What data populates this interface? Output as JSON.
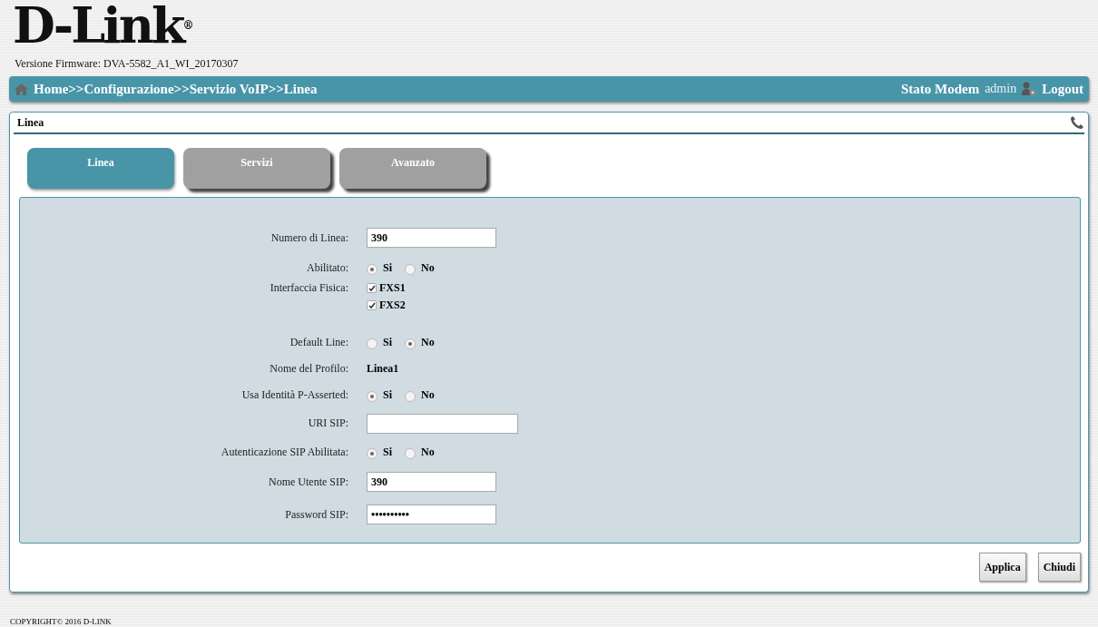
{
  "logo": "D-Link",
  "logo_mark": "®",
  "firmware": "Versione Firmware: DVA-5582_A1_WI_20170307",
  "breadcrumb": "Home>>Configurazione>>Servizio VoIP>>Linea",
  "nav_right": {
    "status_link": "Stato Modem",
    "user": "admin",
    "logout": "Logout"
  },
  "panel": {
    "title": "Linea"
  },
  "tabs": [
    {
      "label": "Linea",
      "selected": true
    },
    {
      "label": "Servizi",
      "selected": false
    },
    {
      "label": "Avanzato",
      "selected": false
    }
  ],
  "fields": [
    {
      "kind": "text",
      "label": "Numero di Linea:",
      "value": "390"
    },
    {
      "kind": "radio",
      "label": "Abilitato:",
      "options": [
        {
          "label": "Si",
          "selected": true
        },
        {
          "label": "No",
          "selected": false
        }
      ]
    },
    {
      "kind": "checkboxes",
      "label": "Interfaccia Fisica:",
      "options": [
        {
          "label": "FXS1",
          "checked": true
        },
        {
          "label": "FXS2",
          "checked": true
        }
      ]
    },
    {
      "kind": "radio",
      "label": "Default Line:",
      "options": [
        {
          "label": "Si",
          "selected": false
        },
        {
          "label": "No",
          "selected": true
        }
      ]
    },
    {
      "kind": "static",
      "label": "Nome del Profilo:",
      "value": "Linea1"
    },
    {
      "kind": "radio",
      "label": "Usa Identità P-Asserted:",
      "options": [
        {
          "label": "Si",
          "selected": true
        },
        {
          "label": "No",
          "selected": false
        }
      ]
    },
    {
      "kind": "wide_text",
      "label": "URI SIP:"
    },
    {
      "kind": "radio",
      "label": "Autenticazione SIP Abilitata:",
      "options": [
        {
          "label": "Si",
          "selected": true
        },
        {
          "label": "No",
          "selected": false
        }
      ]
    },
    {
      "kind": "text",
      "label": "Nome Utente SIP:",
      "value": "390"
    },
    {
      "kind": "text",
      "label": "Password SIP:",
      "value": "••••••••••"
    }
  ],
  "buttons": [
    "Applica",
    "Chiudi"
  ],
  "copyright": "COPYRIGHT© 2016 D-LINK"
}
